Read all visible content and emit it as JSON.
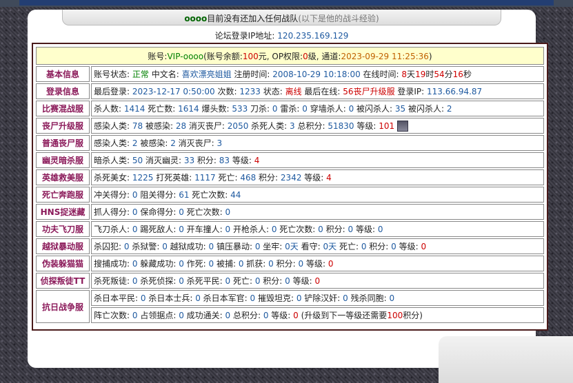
{
  "header": {
    "clan_name": "oooo",
    "title_text": "目前没有还加入任何战队",
    "title_hint": "(以下是他的战斗经验)",
    "ip_label": "论坛登录IP地址:",
    "ip_value": "120.235.169.129"
  },
  "account": {
    "label": "账号:",
    "name": "VIP-oooo",
    "balance_label": "(账号余额:",
    "balance": "100",
    "balance_unit": "元, OP权限:",
    "op_level": "0",
    "op_unit": "级, 通道:",
    "timestamp": "2023-09-29 11:25:36",
    "close": ")"
  },
  "rows": [
    {
      "label": "基本信息",
      "parts": [
        {
          "t": "账号状态: "
        },
        {
          "t": "正常",
          "c": "g"
        },
        {
          "t": " 中文名: "
        },
        {
          "t": "喜欢漂亮姐姐",
          "c": "b"
        },
        {
          "t": " 注册时间: "
        },
        {
          "t": "2008-10-29 10:18:00",
          "c": "b"
        },
        {
          "t": " 在线时间: "
        },
        {
          "t": "8",
          "c": "r"
        },
        {
          "t": "天"
        },
        {
          "t": "19",
          "c": "r"
        },
        {
          "t": "时"
        },
        {
          "t": "54",
          "c": "r"
        },
        {
          "t": "分"
        },
        {
          "t": "16",
          "c": "r"
        },
        {
          "t": "秒"
        }
      ]
    },
    {
      "label": "登录信息",
      "parts": [
        {
          "t": "最后登录: "
        },
        {
          "t": "2023-12-17 0:50:00",
          "c": "b"
        },
        {
          "t": " 次数: "
        },
        {
          "t": "1233",
          "c": "b"
        },
        {
          "t": " 状态: "
        },
        {
          "t": "离线",
          "c": "r"
        },
        {
          "t": " 最后在线: "
        },
        {
          "t": "56丧尸升级服",
          "c": "r"
        },
        {
          "t": " 登录IP: "
        },
        {
          "t": "113.66.94.87",
          "c": "b"
        }
      ]
    },
    {
      "label": "比赛混战服",
      "parts": [
        {
          "t": "杀人数: "
        },
        {
          "t": "1414",
          "c": "b"
        },
        {
          "t": " 死亡数: "
        },
        {
          "t": "1614",
          "c": "b"
        },
        {
          "t": " 爆头数: "
        },
        {
          "t": "533",
          "c": "b"
        },
        {
          "t": " 刀杀: "
        },
        {
          "t": "0",
          "c": "b"
        },
        {
          "t": " 雷杀: "
        },
        {
          "t": "0",
          "c": "b"
        },
        {
          "t": " 穿墙杀人: "
        },
        {
          "t": "0",
          "c": "b"
        },
        {
          "t": " 被闪杀人: "
        },
        {
          "t": "35",
          "c": "b"
        },
        {
          "t": " 被闪杀人: "
        },
        {
          "t": "2",
          "c": "b"
        }
      ]
    },
    {
      "label": "丧尸升级服",
      "rank_icon": true,
      "parts": [
        {
          "t": "感染人类: "
        },
        {
          "t": "78",
          "c": "b"
        },
        {
          "t": " 被感染: "
        },
        {
          "t": "28",
          "c": "b"
        },
        {
          "t": " 消灭丧尸: "
        },
        {
          "t": "2050",
          "c": "b"
        },
        {
          "t": " 杀死人类: "
        },
        {
          "t": "3",
          "c": "b"
        },
        {
          "t": " 总积分: "
        },
        {
          "t": "51830",
          "c": "b"
        },
        {
          "t": " 等级: "
        },
        {
          "t": "101",
          "c": "r"
        }
      ]
    },
    {
      "label": "普通丧尸服",
      "parts": [
        {
          "t": "感染人类: "
        },
        {
          "t": "2",
          "c": "b"
        },
        {
          "t": " 被感染: "
        },
        {
          "t": "2",
          "c": "b"
        },
        {
          "t": " 消灭丧尸: "
        },
        {
          "t": "3",
          "c": "b"
        }
      ]
    },
    {
      "label": "幽灵暗杀服",
      "parts": [
        {
          "t": "暗杀人类: "
        },
        {
          "t": "50",
          "c": "b"
        },
        {
          "t": " 消灭幽灵: "
        },
        {
          "t": "33",
          "c": "b"
        },
        {
          "t": " 积分: "
        },
        {
          "t": "83",
          "c": "b"
        },
        {
          "t": " 等级: "
        },
        {
          "t": "4",
          "c": "r"
        }
      ]
    },
    {
      "label": "英雄救美服",
      "parts": [
        {
          "t": "杀死美女: "
        },
        {
          "t": "1225",
          "c": "b"
        },
        {
          "t": " 打死英雄: "
        },
        {
          "t": "1117",
          "c": "b"
        },
        {
          "t": " 死亡: "
        },
        {
          "t": "468",
          "c": "b"
        },
        {
          "t": " 积分: "
        },
        {
          "t": "2342",
          "c": "b"
        },
        {
          "t": " 等级: "
        },
        {
          "t": "4",
          "c": "r"
        }
      ]
    },
    {
      "label": "死亡奔跑服",
      "parts": [
        {
          "t": "冲关得分: "
        },
        {
          "t": "0",
          "c": "b"
        },
        {
          "t": " 阻关得分: "
        },
        {
          "t": "61",
          "c": "b"
        },
        {
          "t": " 死亡次数: "
        },
        {
          "t": "44",
          "c": "b"
        }
      ]
    },
    {
      "label": "HNS捉迷藏",
      "parts": [
        {
          "t": "抓人得分: "
        },
        {
          "t": "0",
          "c": "b"
        },
        {
          "t": " 保命得分: "
        },
        {
          "t": "0",
          "c": "b"
        },
        {
          "t": " 死亡次数: "
        },
        {
          "t": "0",
          "c": "b"
        }
      ]
    },
    {
      "label": "功夫飞刀服",
      "parts": [
        {
          "t": "飞刀杀人: "
        },
        {
          "t": "0",
          "c": "b"
        },
        {
          "t": " 踢死敌人: "
        },
        {
          "t": "0",
          "c": "b"
        },
        {
          "t": " 开车撞人: "
        },
        {
          "t": "0",
          "c": "b"
        },
        {
          "t": " 开枪杀人: "
        },
        {
          "t": "0",
          "c": "b"
        },
        {
          "t": " 死亡次数: "
        },
        {
          "t": "0",
          "c": "b"
        },
        {
          "t": " 积分: "
        },
        {
          "t": "0",
          "c": "b"
        },
        {
          "t": " 等级: "
        },
        {
          "t": "0",
          "c": "b"
        }
      ]
    },
    {
      "label": "越狱暴动服",
      "parts": [
        {
          "t": "杀囚犯: "
        },
        {
          "t": "0",
          "c": "b"
        },
        {
          "t": " 杀狱警: "
        },
        {
          "t": "0",
          "c": "b"
        },
        {
          "t": " 越狱成功: "
        },
        {
          "t": "0",
          "c": "b"
        },
        {
          "t": " 镇压暴动: "
        },
        {
          "t": "0",
          "c": "b"
        },
        {
          "t": " 坐牢: "
        },
        {
          "t": "0天",
          "c": "b"
        },
        {
          "t": " 看守: "
        },
        {
          "t": "0天",
          "c": "b"
        },
        {
          "t": " 死亡: "
        },
        {
          "t": "0",
          "c": "b"
        },
        {
          "t": " 积分: "
        },
        {
          "t": "0",
          "c": "b"
        },
        {
          "t": " 等级: "
        },
        {
          "t": "0",
          "c": "r"
        }
      ]
    },
    {
      "label": "伪装躲猫猫",
      "parts": [
        {
          "t": "搜捕成功: "
        },
        {
          "t": "0",
          "c": "b"
        },
        {
          "t": " 躲藏成功: "
        },
        {
          "t": "0",
          "c": "b"
        },
        {
          "t": " 作死: "
        },
        {
          "t": "0",
          "c": "b"
        },
        {
          "t": " 被捕: "
        },
        {
          "t": "0",
          "c": "b"
        },
        {
          "t": " 抓获: "
        },
        {
          "t": "0",
          "c": "b"
        },
        {
          "t": " 积分: "
        },
        {
          "t": "0",
          "c": "b"
        },
        {
          "t": " 等级: "
        },
        {
          "t": "0",
          "c": "r"
        }
      ]
    },
    {
      "label": "侦探叛徒TT",
      "parts": [
        {
          "t": "杀死叛徒: "
        },
        {
          "t": "0",
          "c": "b"
        },
        {
          "t": " 杀死侦探: "
        },
        {
          "t": "0",
          "c": "b"
        },
        {
          "t": " 杀死平民: "
        },
        {
          "t": "0",
          "c": "b"
        },
        {
          "t": " 死亡: "
        },
        {
          "t": "0",
          "c": "b"
        },
        {
          "t": " 积分: "
        },
        {
          "t": "0",
          "c": "b"
        },
        {
          "t": " 等级: "
        },
        {
          "t": "0",
          "c": "r"
        }
      ]
    }
  ],
  "war_row": {
    "label": "抗日战争服",
    "line1": [
      {
        "t": "杀日本平民: "
      },
      {
        "t": "0",
        "c": "b"
      },
      {
        "t": " 杀日本士兵: "
      },
      {
        "t": "0",
        "c": "b"
      },
      {
        "t": " 杀日本军官: "
      },
      {
        "t": "0",
        "c": "b"
      },
      {
        "t": " 摧毁坦克: "
      },
      {
        "t": "0",
        "c": "b"
      },
      {
        "t": " 铲除汉奸: "
      },
      {
        "t": "0",
        "c": "b"
      },
      {
        "t": " 残杀同胞: "
      },
      {
        "t": "0",
        "c": "b"
      }
    ],
    "line2": [
      {
        "t": "阵亡次数: "
      },
      {
        "t": "0",
        "c": "b"
      },
      {
        "t": " 占领据点: "
      },
      {
        "t": "0",
        "c": "b"
      },
      {
        "t": " 成功通关: "
      },
      {
        "t": "0",
        "c": "b"
      },
      {
        "t": " 总积分: "
      },
      {
        "t": "0",
        "c": "b"
      },
      {
        "t": " 等级: "
      },
      {
        "t": "0",
        "c": "r"
      },
      {
        "t": " (升级到下一等级还需要"
      },
      {
        "t": "100",
        "c": "r"
      },
      {
        "t": "积分)"
      }
    ]
  }
}
